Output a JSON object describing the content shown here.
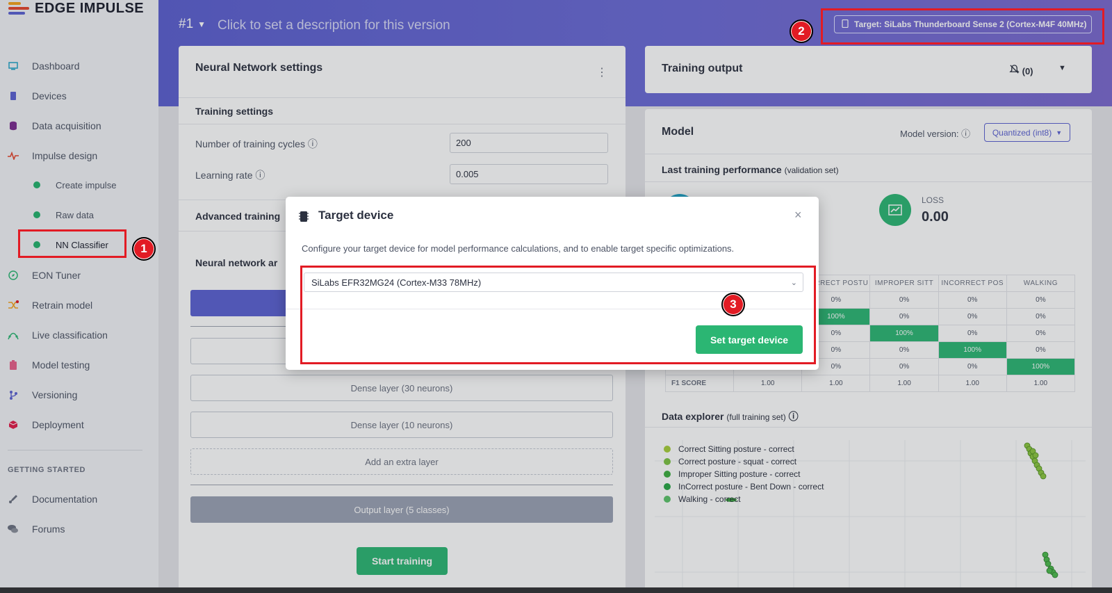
{
  "brand": {
    "name": "EDGE IMPULSE"
  },
  "sidebar": {
    "items": [
      {
        "label": "Dashboard",
        "icon": "monitor-icon"
      },
      {
        "label": "Devices",
        "icon": "chip-icon"
      },
      {
        "label": "Data acquisition",
        "icon": "database-icon"
      },
      {
        "label": "Impulse design",
        "icon": "pulse-icon"
      },
      {
        "label": "EON Tuner",
        "icon": "compass-icon"
      },
      {
        "label": "Retrain model",
        "icon": "shuffle-icon"
      },
      {
        "label": "Live classification",
        "icon": "curve-icon"
      },
      {
        "label": "Model testing",
        "icon": "clipboard-icon"
      },
      {
        "label": "Versioning",
        "icon": "branch-icon"
      },
      {
        "label": "Deployment",
        "icon": "box-icon"
      }
    ],
    "sub_items": [
      {
        "label": "Create impulse"
      },
      {
        "label": "Raw data"
      },
      {
        "label": "NN Classifier"
      }
    ],
    "getting_started_heading": "GETTING STARTED",
    "help_items": [
      {
        "label": "Documentation",
        "icon": "rocket-icon"
      },
      {
        "label": "Forums",
        "icon": "chat-icon"
      }
    ]
  },
  "header": {
    "version": "#1",
    "description_placeholder": "Click to set a description for this version",
    "target_label": "Target: SiLabs Thunderboard Sense 2 (Cortex-M4F 40MHz)"
  },
  "nn_settings": {
    "title": "Neural Network settings",
    "training_settings": "Training settings",
    "cycles_label": "Number of training cycles",
    "cycles_value": "200",
    "lr_label": "Learning rate",
    "lr_value": "0.005",
    "advanced_label": "Advanced training",
    "architecture_label": "Neural network ar",
    "layers": [
      {
        "label": "Dense layer (30 neurons)"
      },
      {
        "label": "Dense layer (10 neurons)"
      },
      {
        "label": "Add an extra layer"
      },
      {
        "label": "Output layer (5 classes)"
      }
    ],
    "start_button": "Start training"
  },
  "training_output": {
    "title": "Training output",
    "notifications": "(0)"
  },
  "model": {
    "title": "Model",
    "version_label": "Model version:",
    "version_value": "Quantized (int8)",
    "perf_title": "Last training performance",
    "perf_sub": "(validation set)",
    "loss_label": "LOSS",
    "loss_value": "0.00",
    "matrix_headers": [
      "",
      "",
      "CORRECT POSTU",
      "IMPROPER SITT",
      "INCORRECT POS",
      "WALKING"
    ],
    "matrix_rows": [
      {
        "label": "",
        "cells": [
          "",
          "0%",
          "0%",
          "0%",
          "0%"
        ]
      },
      {
        "label": "",
        "cells": [
          "",
          "100%",
          "0%",
          "0%",
          "0%"
        ]
      },
      {
        "label": "",
        "cells": [
          "",
          "0%",
          "100%",
          "0%",
          "0%"
        ]
      },
      {
        "label": "",
        "cells": [
          "",
          "0%",
          "0%",
          "100%",
          "0%"
        ]
      },
      {
        "label": "",
        "cells": [
          "",
          "0%",
          "0%",
          "0%",
          "100%"
        ]
      },
      {
        "label": "F1 SCORE",
        "cells": [
          "1.00",
          "1.00",
          "1.00",
          "1.00",
          "1.00"
        ]
      }
    ],
    "explorer_title": "Data explorer",
    "explorer_sub": "(full training set)",
    "legend": [
      {
        "label": "Correct Sitting posture - correct",
        "color": "#a6cf3a"
      },
      {
        "label": "Correct posture - squat - correct",
        "color": "#7cc242"
      },
      {
        "label": "Improper Sitting posture - correct",
        "color": "#3cae3f"
      },
      {
        "label": "InCorrect posture - Bent Down - correct",
        "color": "#28a745"
      },
      {
        "label": "Walking - correct",
        "color": "#5cc46a"
      }
    ]
  },
  "modal": {
    "title": "Target device",
    "close": "×",
    "description": "Configure your target device for model performance calculations, and to enable target specific optimizations.",
    "selected_device": "SiLabs EFR32MG24 (Cortex-M33 78MHz)",
    "button": "Set target device"
  },
  "annotations": [
    "1",
    "2",
    "3"
  ],
  "colors": {
    "accent": "#5b61d2",
    "success": "#2bb673",
    "annotation": "#e21b24"
  }
}
